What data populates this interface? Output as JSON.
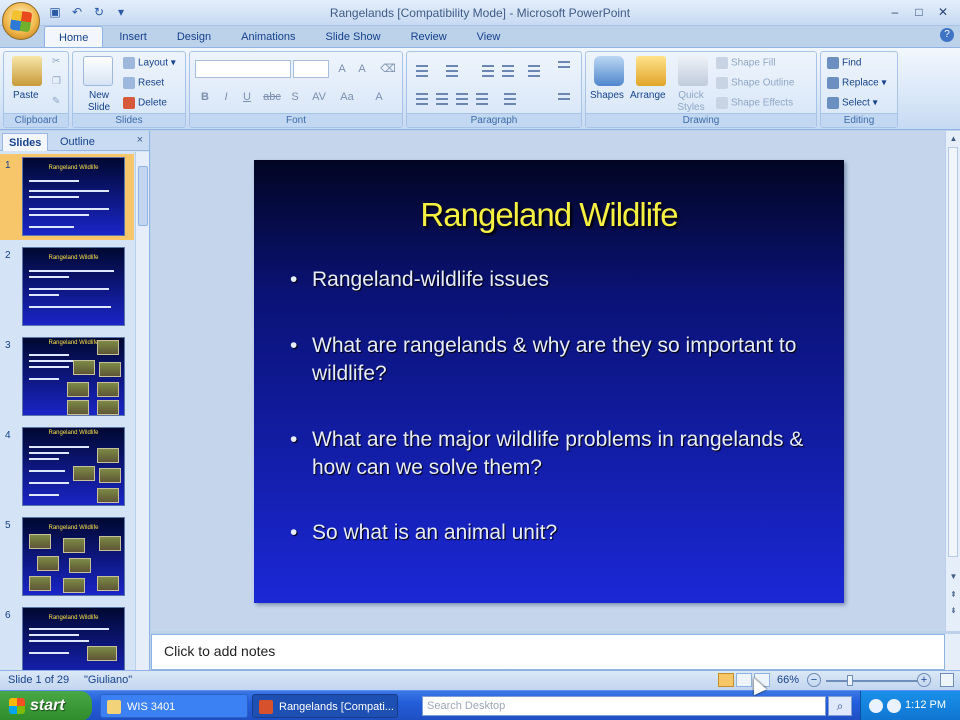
{
  "window": {
    "title": "Rangelands [Compatibility Mode] - Microsoft PowerPoint",
    "controls": [
      "–",
      "□",
      "✕"
    ]
  },
  "qat": [
    "save-icon",
    "undo-icon",
    "redo-icon",
    "customize-icon"
  ],
  "ribbon": {
    "tabs": [
      "Home",
      "Insert",
      "Design",
      "Animations",
      "Slide Show",
      "Review",
      "View"
    ],
    "active_tab": "Home",
    "groups": {
      "clipboard": {
        "label": "Clipboard",
        "paste": "Paste"
      },
      "slides": {
        "label": "Slides",
        "new_slide": "New Slide",
        "layout": "Layout",
        "reset": "Reset",
        "delete": "Delete"
      },
      "font": {
        "label": "Font",
        "bold": "B",
        "italic": "I",
        "underline": "U",
        "strike": "abc",
        "shadow": "S",
        "spacing": "AV",
        "case": "Aa",
        "color": "A"
      },
      "paragraph": {
        "label": "Paragraph"
      },
      "drawing": {
        "label": "Drawing",
        "shapes": "Shapes",
        "arrange": "Arrange",
        "quick_styles": "Quick Styles",
        "shape_fill": "Shape Fill",
        "shape_outline": "Shape Outline",
        "shape_effects": "Shape Effects"
      },
      "editing": {
        "label": "Editing",
        "find": "Find",
        "replace": "Replace",
        "select": "Select"
      }
    }
  },
  "panel": {
    "tabs": [
      "Slides",
      "Outline"
    ],
    "close": "×",
    "thumbnails": [
      {
        "num": "1",
        "title": "Rangeland Wildlife",
        "selected": true
      },
      {
        "num": "2",
        "title": "Rangeland Wildlife",
        "selected": false
      },
      {
        "num": "3",
        "title": "Rangeland Wildlife",
        "selected": false
      },
      {
        "num": "4",
        "title": "Rangeland Wildlife",
        "selected": false
      },
      {
        "num": "5",
        "title": "Rangeland Wildlife",
        "selected": false
      },
      {
        "num": "6",
        "title": "Rangeland Wildlife",
        "selected": false
      }
    ]
  },
  "slide": {
    "title": "Rangeland Wildlife",
    "bullets": [
      "Rangeland-wildlife issues",
      "What are rangelands & why are they so important to wildlife?",
      "What are the major wildlife problems in rangelands & how can we solve them?",
      "So what is an animal unit?"
    ]
  },
  "notes": {
    "placeholder": "Click to add notes"
  },
  "status": {
    "slide": "Slide 1 of 29",
    "theme": "\"Giuliano\"",
    "zoom": "66%",
    "zoom_fraction": 0.26
  },
  "taskbar": {
    "start": "start",
    "tasks": [
      "WIS 3401",
      "Rangelands [Compati..."
    ],
    "search_placeholder": "Search Desktop",
    "clock": "1:12 PM"
  }
}
